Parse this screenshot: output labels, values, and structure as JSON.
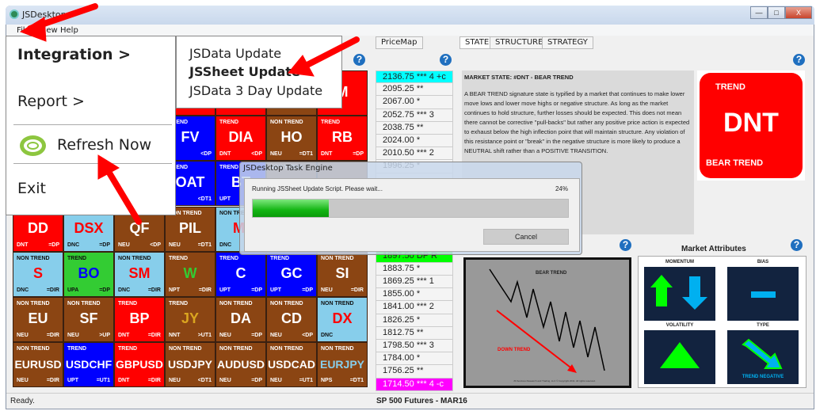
{
  "window": {
    "title": "JSDesktop",
    "min": "—",
    "max": "□",
    "close": "X"
  },
  "menubar": [
    "File",
    "View",
    "Help"
  ],
  "tabs_left": [
    "PriceMap"
  ],
  "tabs_right": [
    "STATE",
    "STRUCTURE",
    "STRATEGY"
  ],
  "file_menu": {
    "items": [
      "Integration >",
      "Report >",
      "Refresh Now",
      "Exit"
    ]
  },
  "integration_submenu": [
    "JSData Update",
    "JSSheet Update",
    "JSData 3 Day Update"
  ],
  "colors": {
    "red": "#ff0000",
    "blue": "#0000ff",
    "brown": "#8b4513",
    "lightblue": "#87ceeb",
    "green": "#33cc33",
    "cyan": "#00ffff",
    "magenta": "#ff00ff",
    "lime": "#00ff00"
  },
  "grid": [
    [
      {
        "bg": "brown"
      },
      {
        "bg": "brown"
      },
      {
        "bg": "brown"
      },
      {
        "bg": "red"
      },
      {
        "bg": "red"
      },
      {
        "bg": "brown"
      },
      {
        "bg": "red",
        "code": "M"
      }
    ],
    [
      {
        "bg": "brown"
      },
      {
        "bg": "brown"
      },
      {
        "bg": "brown"
      },
      {
        "bg": "blue",
        "label": "TREND",
        "code": "FV",
        "br": "<DP"
      },
      {
        "bg": "red",
        "label": "TREND",
        "code": "DIA",
        "bl": "DNT",
        "br": "<DP"
      },
      {
        "bg": "brown",
        "label": "NON TREND",
        "code": "HO",
        "bl": "NEU",
        "br": "=DT1"
      },
      {
        "bg": "red",
        "label": "TREND",
        "code": "RB",
        "bl": "DNT",
        "br": "=DP"
      }
    ],
    [
      {
        "bg": "brown"
      },
      {
        "bg": "brown"
      },
      {
        "bg": "brown"
      },
      {
        "bg": "blue",
        "label": "TREND",
        "code": "OAT",
        "br": "<DT1"
      },
      {
        "bg": "blue",
        "label": "TREND",
        "code": "BT",
        "bl": "UPT"
      },
      {
        "bg": "brown",
        "label": "NON TREND"
      },
      {
        "bg": "brown"
      }
    ],
    [
      {
        "bg": "red",
        "code": "DD",
        "bl": "DNT",
        "br": "=DP"
      },
      {
        "bg": "lightblue",
        "code": "DSX",
        "codeColor": "#ff0000",
        "bl": "DNC",
        "br": "=DP"
      },
      {
        "bg": "brown",
        "code": "QF",
        "bl": "NEU",
        "br": "<DP"
      },
      {
        "bg": "brown",
        "label": "NON TREND",
        "code": "PIL",
        "bl": "NEU",
        "br": "=DT1"
      },
      {
        "bg": "lightblue",
        "label": "NON TREND",
        "code": "MI",
        "codeColor": "#ff0000",
        "bl": "DNC"
      },
      {
        "bg": "brown"
      },
      {
        "bg": "brown"
      }
    ],
    [
      {
        "bg": "lightblue",
        "label": "NON TREND",
        "code": "S",
        "codeColor": "#ff0000",
        "bl": "DNC",
        "br": "=DIR"
      },
      {
        "bg": "green",
        "label": "TREND",
        "code": "BO",
        "codeColor": "#0000ff",
        "bl": "UPA",
        "br": "=DP"
      },
      {
        "bg": "lightblue",
        "label": "NON TREND",
        "code": "SM",
        "codeColor": "#ff0000",
        "bl": "DNC",
        "br": "=DIR"
      },
      {
        "bg": "brown",
        "label": "TREND",
        "code": "W",
        "codeColor": "#33cc33",
        "bl": "NPT",
        "br": "=DIR"
      },
      {
        "bg": "blue",
        "label": "TREND",
        "code": "C",
        "bl": "UPT",
        "br": "=DP"
      },
      {
        "bg": "blue",
        "label": "TREND",
        "code": "GC",
        "bl": "UPT",
        "br": "=DP"
      },
      {
        "bg": "brown",
        "label": "NON TREND",
        "code": "SI",
        "bl": "NEU",
        "br": "=DIR"
      }
    ],
    [
      {
        "bg": "brown",
        "label": "NON TREND",
        "code": "EU",
        "bl": "NEU",
        "br": "=DIR"
      },
      {
        "bg": "brown",
        "label": "NON TREND",
        "code": "SF",
        "bl": "NEU",
        "br": ">UP"
      },
      {
        "bg": "red",
        "label": "TREND",
        "code": "BP",
        "bl": "DNT",
        "br": "=DIR"
      },
      {
        "bg": "brown",
        "label": "TREND",
        "code": "JY",
        "codeColor": "#daa520",
        "bl": "NNT",
        "br": ">UT1"
      },
      {
        "bg": "brown",
        "label": "NON TREND",
        "code": "DA",
        "bl": "NEU",
        "br": "=DP"
      },
      {
        "bg": "brown",
        "label": "NON TREND",
        "code": "CD",
        "bl": "NEU",
        "br": "<DP"
      },
      {
        "bg": "lightblue",
        "label": "NON TREND",
        "code": "DX",
        "codeColor": "#ff0000",
        "bl": "DNC"
      }
    ],
    [
      {
        "bg": "brown",
        "label": "NON TREND",
        "code": "EURUSD",
        "bl": "NEU",
        "br": "=DIR"
      },
      {
        "bg": "blue",
        "label": "TREND",
        "code": "USDCHF",
        "bl": "UPT",
        "br": "=UT1"
      },
      {
        "bg": "red",
        "label": "TREND",
        "code": "GBPUSD",
        "bl": "DNT",
        "br": "=DIR"
      },
      {
        "bg": "brown",
        "label": "NON TREND",
        "code": "USDJPY",
        "bl": "NEU",
        "br": "<DT1"
      },
      {
        "bg": "brown",
        "label": "NON TREND",
        "code": "AUDUSD",
        "bl": "NEU",
        "br": "=DP"
      },
      {
        "bg": "brown",
        "label": "NON TREND",
        "code": "USDCAD",
        "bl": "NEU",
        "br": "=UT1"
      },
      {
        "bg": "brown",
        "label": "NON TREND",
        "code": "EURJPY",
        "codeColor": "#87ceeb",
        "bl": "NPS",
        "br": "=DT1"
      }
    ]
  ],
  "prices": [
    {
      "text": "2136.75 *** 4 +c",
      "bg": "cyan"
    },
    {
      "text": "2095.25 **"
    },
    {
      "text": "2067.00 *"
    },
    {
      "text": "2052.75 *** 3"
    },
    {
      "text": "2038.75 **"
    },
    {
      "text": "2024.00 *"
    },
    {
      "text": "2010.50 *** 2"
    },
    {
      "text": "1996.25 *"
    },
    {
      "text": ""
    },
    {
      "text": ""
    },
    {
      "text": ""
    },
    {
      "text": ""
    },
    {
      "text": ""
    },
    {
      "text": ""
    },
    {
      "text": "1897.50 DP R",
      "bg": "lime"
    },
    {
      "text": "1883.75 *"
    },
    {
      "text": "1869.25 *** 1"
    },
    {
      "text": "1855.00 *"
    },
    {
      "text": "1841.00 *** 2"
    },
    {
      "text": "1826.25 *"
    },
    {
      "text": "1812.75 **"
    },
    {
      "text": "1798.50 *** 3"
    },
    {
      "text": "1784.00 *"
    },
    {
      "text": "1756.25 **"
    },
    {
      "text": "1714.50 *** 4 -c",
      "bg": "magenta"
    }
  ],
  "state": {
    "heading": "MARKET STATE: #DNT - BEAR TREND",
    "body": "A BEAR TREND signature state is typified by a market that continues to make lower move lows and lower move highs or negative structure. As long as the market continues to hold structure, further losses should be expected. This does not mean there cannot be corrective \"pull-backs\" but rather any positive price action is expected to exhaust below the high inflection point that will maintain structure. Any violation of this resistance point or \"break\" in the negative structure is more likely to produce a NEUTRAL shift rather than a POSITIVE TRANSITION."
  },
  "dnt_badge": {
    "top": "TREND",
    "code": "DNT",
    "bottom": "BEAR TREND"
  },
  "diagram": {
    "title": "BEAR TREND",
    "label": "DOWN TREND",
    "copyright": "JS Services Research and Trading, LLC © Copyright 2011. All rights reserved."
  },
  "attributes": {
    "title": "Market Attributes",
    "momentum": "MOMENTUM",
    "bias": "BIAS",
    "volatility": "VOLATILITY",
    "type": "TYPE",
    "type_value": "TREND NEGATIVE"
  },
  "dialog": {
    "title": "JSDesktop Task Engine",
    "message": "Running JSSheet Update Script. Please wait...",
    "percent_label": "24%",
    "progress": 0.24,
    "cancel": "Cancel"
  },
  "status": {
    "left": "Ready.",
    "center": "SP 500 Futures - MAR16"
  }
}
